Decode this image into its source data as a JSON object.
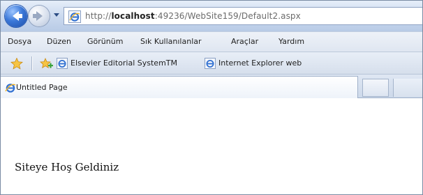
{
  "address_bar": {
    "url_prefix": "http://",
    "url_host": "localhost",
    "url_rest": ":49236/WebSite159/Default2.aspx"
  },
  "menu": {
    "items": [
      "Dosya",
      "Düzen",
      "Görünüm",
      "Sık Kullanılanlar",
      "Araçlar",
      "Yardım"
    ]
  },
  "favorites_bar": {
    "items": [
      {
        "label": "Elsevier Editorial SystemTM",
        "icon": "ie-page-icon"
      },
      {
        "label": "Internet Explorer web",
        "icon": "ie-page-icon"
      }
    ]
  },
  "tabs": {
    "active_title": "Untitled Page"
  },
  "page": {
    "welcome_text": "Siteye Hoş Geldiniz"
  },
  "colors": {
    "chrome_blue": "#c9d8ee",
    "back_button": "#3b78d8"
  }
}
